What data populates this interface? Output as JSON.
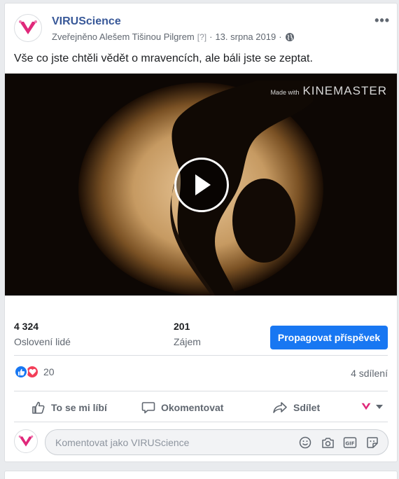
{
  "post": {
    "page_name": "VIRUScience",
    "published_by": "Zveřejněno Alešem Tišinou Pilgrem",
    "help_mark": "[?]",
    "separator": "·",
    "date": "13. srpna 2019",
    "more_label": "•••",
    "caption": "Vše co jste chtěli vědět o mravencích, ale báli jste se zeptat."
  },
  "video": {
    "watermark_small": "Made with",
    "watermark_big": "KINEMASTER"
  },
  "stats": {
    "reach_value": "4 324",
    "reach_label": "Oslovení lidé",
    "engagement_value": "201",
    "engagement_label": "Zájem",
    "promote_label": "Propagovat příspěvek"
  },
  "reactions": {
    "count": "20",
    "shares": "4 sdílení"
  },
  "actions": {
    "like": "To se mi líbí",
    "comment": "Okomentovat",
    "share": "Sdílet"
  },
  "comment": {
    "placeholder": "Komentovat jako VIRUScience"
  },
  "colors": {
    "brand_blue": "#1877f2",
    "name_blue": "#385898",
    "logo_pink": "#e0287a"
  }
}
